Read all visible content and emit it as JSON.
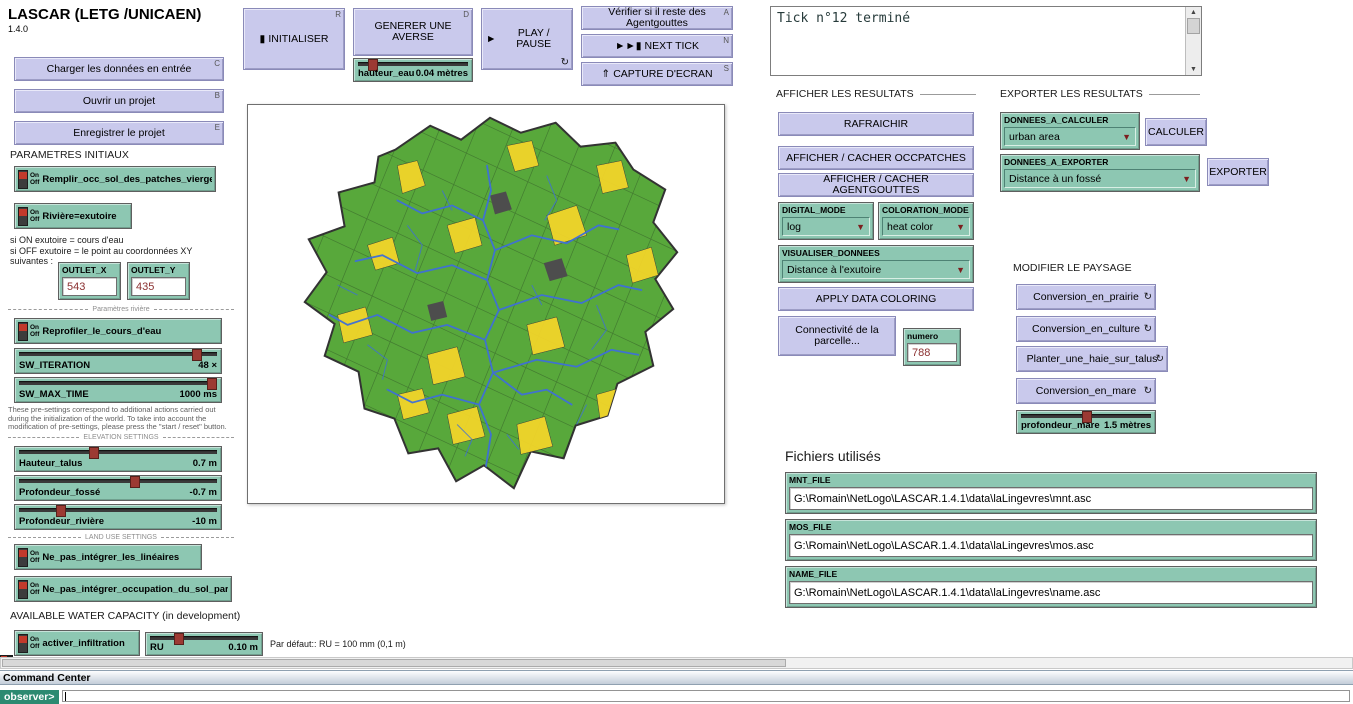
{
  "ui": {
    "on": "On",
    "off": "Off",
    "forever": "↻",
    "dropdown": "▼",
    "scroll_up": "▲",
    "scroll_down": "▼"
  },
  "colors": {
    "button_lavender": "#c9c9ec",
    "widget_teal": "#8dc7b2",
    "map_green": "#58a83b",
    "map_yellow": "#f2d42a",
    "map_stream_blue": "#3f6fd8",
    "slider_handle_red": "#9c3a33"
  },
  "header": {
    "title": "LASCAR (LETG /UNICAEN)",
    "version": "1.4.0"
  },
  "left": {
    "file_buttons": [
      {
        "label": "Charger les données en entrée",
        "key": "C"
      },
      {
        "label": "Ouvrir un projet",
        "key": "B"
      },
      {
        "label": "Enregistrer le projet",
        "key": "E"
      }
    ],
    "section_init": "PARAMETRES INITIAUX",
    "switch_remplir": {
      "label": "Remplir_occ_sol_des_patches_vierges"
    },
    "switch_riviere": {
      "label": "Rivière=exutoire"
    },
    "outlet_note_lines": [
      "si ON exutoire = cours d'eau",
      "si OFF exutoire = le point au coordonnées XY",
      "suivantes :"
    ],
    "outlet_x": {
      "label": "OUTLET_X",
      "value": "543"
    },
    "outlet_y": {
      "label": "OUTLET_Y",
      "value": "435"
    },
    "divider_riviere": "Paramètres rivière",
    "switch_reprofiler": {
      "label": "Reprofiler_le_cours_d'eau"
    },
    "slider_sw_iteration": {
      "label": "SW_ITERATION",
      "value": "48 ×"
    },
    "slider_sw_max_time": {
      "label": "SW_MAX_TIME",
      "value": "1000 ms"
    },
    "presettings_note": "These pre-settings correspond to additional actions carried out during the initialization of the world. To take into account the modification of pre-settings, please press the \"start / reset\" button.",
    "divider_elevation": "ELEVATION SETTINGS",
    "slider_hauteur_talus": {
      "label": "Hauteur_talus",
      "value": "0.7 m"
    },
    "slider_profondeur_fosse": {
      "label": "Profondeur_fossé",
      "value": "-0.7 m"
    },
    "slider_profondeur_riviere": {
      "label": "Profondeur_rivière",
      "value": "-10 m"
    },
    "divider_landuse": "LAND USE SETTINGS",
    "switch_lineaires": {
      "label": "Ne_pas_intégrer_les_linéaires"
    },
    "switch_occupation": {
      "label": "Ne_pas_intégrer_occupation_du_sol_parcelles"
    },
    "section_awc": "AVAILABLE WATER CAPACITY (in development)",
    "switch_infiltration": {
      "label": "activer_infiltration"
    },
    "slider_ru": {
      "label": "RU",
      "value": "0.10 m"
    },
    "ru_note": "Par défaut:: RU = 100 mm (0,1 m)"
  },
  "toolbar": {
    "initialiser": {
      "label": "INITIALISER",
      "key": "R",
      "icon": "▮"
    },
    "generer_averse": {
      "label": "GENERER UNE AVERSE",
      "key": "D"
    },
    "slider_hauteur_eau": {
      "label": "hauteur_eau",
      "value": "0.04 mètres"
    },
    "play_pause": {
      "label": "PLAY / PAUSE",
      "icon": "►"
    },
    "verifier": {
      "label": "Vérifier si il reste des Agentgouttes",
      "key": "A"
    },
    "next_tick": {
      "label": "NEXT TICK",
      "key": "N",
      "icon": "►►▮"
    },
    "capture": {
      "label": "CAPTURE D'ECRAN",
      "key": "S",
      "icon": "⇑"
    }
  },
  "output": {
    "text": "Tick n°12 terminé"
  },
  "results": {
    "section": "AFFICHER LES RESULTATS",
    "buttons": [
      "RAFRAICHIR",
      "AFFICHER / CACHER OCCPATCHES",
      "AFFICHER / CACHER AGENTGOUTTES"
    ],
    "digital_mode": {
      "label": "DIGITAL_MODE",
      "value": "log"
    },
    "coloration_mode": {
      "label": "COLORATION_MODE",
      "value": "heat color"
    },
    "visualiser_donnees": {
      "label": "VISUALISER_DONNEES",
      "value": "Distance à l'exutoire"
    },
    "apply_button": "APPLY DATA COLORING",
    "connectivite_button": "Connectivité de la parcelle...",
    "numero": {
      "label": "numero",
      "value": "788"
    }
  },
  "exporter": {
    "section": "EXPORTER LES RESULTATS",
    "donnees_a_calculer": {
      "label": "DONNEES_A_CALCULER",
      "value": "urban area"
    },
    "calculer_button": "CALCULER",
    "donnees_a_exporter": {
      "label": "DONNEES_A_EXPORTER",
      "value": "Distance à un fossé"
    },
    "exporter_button": "EXPORTER"
  },
  "paysage": {
    "section": "MODIFIER LE PAYSAGE",
    "buttons": [
      "Conversion_en_prairie",
      "Conversion_en_culture",
      "Planter_une_haie_sur_talus",
      "Conversion_en_mare"
    ],
    "slider_profondeur_mare": {
      "label": "profondeur_mare",
      "value": "1.5 mètres"
    }
  },
  "fichiers": {
    "section": "Fichiers utilisés",
    "files": [
      {
        "label": "MNT_FILE",
        "value": "G:\\Romain\\NetLogo\\LASCAR.1.4.1\\data\\laLingevres\\mnt.asc"
      },
      {
        "label": "MOS_FILE",
        "value": "G:\\Romain\\NetLogo\\LASCAR.1.4.1\\data\\laLingevres\\mos.asc"
      },
      {
        "label": "NAME_FILE",
        "value": "G:\\Romain\\NetLogo\\LASCAR.1.4.1\\data\\laLingevres\\name.asc"
      }
    ]
  },
  "command_center": {
    "title": "Command Center",
    "prompt": "observer>"
  }
}
